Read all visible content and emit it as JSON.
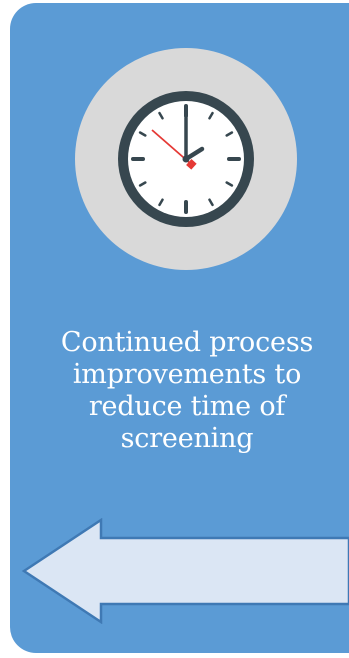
{
  "card": {
    "caption_lines": [
      "Continued process",
      "improvements to",
      "reduce time of",
      "screening"
    ]
  },
  "icons": {
    "clock": "clock-icon",
    "arrow": "arrow-left-icon"
  },
  "colors": {
    "card_background": "#5b9bd5",
    "clock_circle": "#d9d9d9",
    "clock_rim": "#37474f",
    "second_hand": "#e53935",
    "arrow_fill": "#dbe6f4",
    "text": "#ffffff"
  }
}
